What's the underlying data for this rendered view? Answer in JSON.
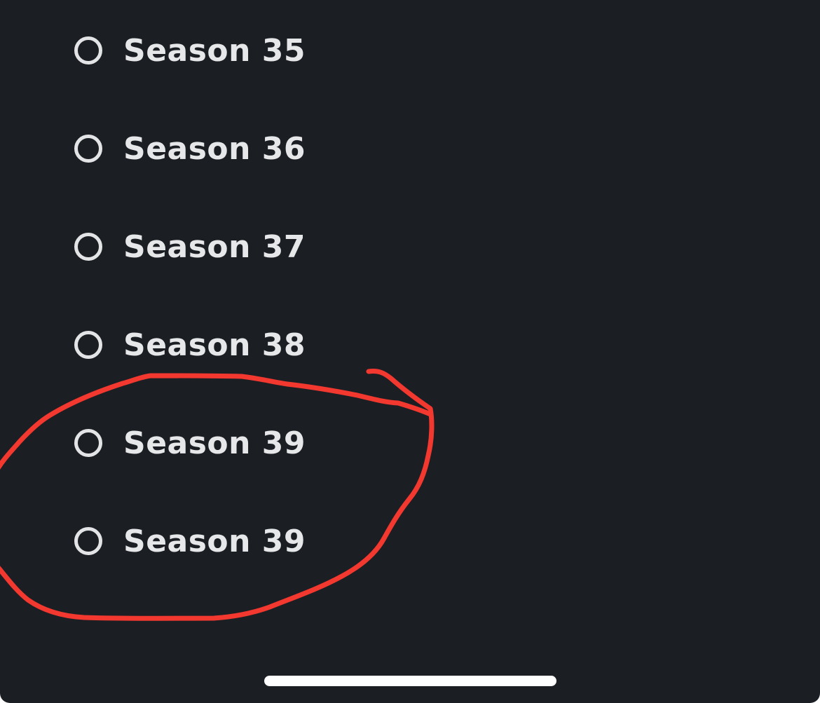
{
  "seasons": [
    {
      "label": "Season 35",
      "selected": false
    },
    {
      "label": "Season 36",
      "selected": false
    },
    {
      "label": "Season 37",
      "selected": false
    },
    {
      "label": "Season 38",
      "selected": false
    },
    {
      "label": "Season 39",
      "selected": false
    },
    {
      "label": "Season 39",
      "selected": false
    }
  ],
  "annotation": {
    "type": "hand-drawn circle",
    "color": "#f2382f",
    "encloses": [
      "Season 39",
      "Season 39"
    ]
  },
  "colors": {
    "background": "#1b1e23",
    "text": "#e6e7e9",
    "radio_border": "#e3e4e6",
    "annotation": "#f2382f"
  }
}
